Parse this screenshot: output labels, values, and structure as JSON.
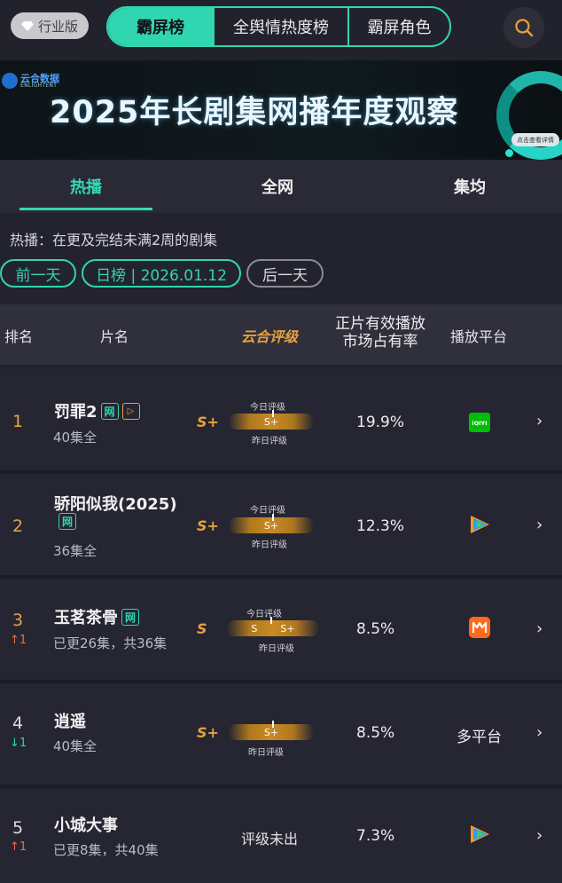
{
  "topbar": {
    "industry_label": "行业版",
    "tabs": [
      "霸屏榜",
      "全舆情热度榜",
      "霸屏角色"
    ],
    "active_tab": "霸屏榜"
  },
  "banner": {
    "brand_cn": "云合数据",
    "brand_en": "ENLIGHTENT",
    "title": "2025年长剧集网播年度观察",
    "detail_btn": "点击查看详情"
  },
  "subtabs": [
    "热播",
    "全网",
    "集均"
  ],
  "active_subtab": "热播",
  "info": {
    "description": "热播：在更及完结未满2周的剧集",
    "prev_day": "前一天",
    "date_label": "日榜 | 2026.01.12",
    "next_day": "后一天"
  },
  "table": {
    "headers": {
      "rank": "排名",
      "title": "片名",
      "grade": "云合评级",
      "share_line1": "正片有效播放",
      "share_line2": "市场占有率",
      "platform": "播放平台"
    },
    "grade_today_label": "今日评级",
    "grade_yesterday_label": "昨日评级",
    "rows": [
      {
        "rank": "1",
        "trend": "",
        "trend_dir": "",
        "title": "罚罪2",
        "net_badge": "网",
        "play_badge": "▷",
        "episodes": "40集全",
        "grade": "S+",
        "bar_left": "S+",
        "bar_right": "",
        "share": "19.9%",
        "platform": "iqiyi-icon",
        "platform_text": "iQIYI"
      },
      {
        "rank": "2",
        "trend": "",
        "trend_dir": "",
        "title": "骄阳似我(2025)",
        "net_badge": "网",
        "play_badge": "",
        "episodes": "36集全",
        "grade": "S+",
        "bar_left": "S+",
        "bar_right": "",
        "share": "12.3%",
        "platform": "tencent-video-icon",
        "platform_text": ""
      },
      {
        "rank": "3",
        "trend": "↑1",
        "trend_dir": "up",
        "title": "玉茗茶骨",
        "net_badge": "网",
        "play_badge": "",
        "episodes": "已更26集，共36集",
        "grade": "S",
        "bar_left": "S",
        "bar_right": "S+",
        "share": "8.5%",
        "platform": "mango-tv-icon",
        "platform_text": ""
      },
      {
        "rank": "4",
        "trend": "↓1",
        "trend_dir": "down",
        "title": "逍遥",
        "net_badge": "",
        "play_badge": "",
        "episodes": "40集全",
        "grade": "S+",
        "bar_left": "S+",
        "bar_right": "",
        "share": "8.5%",
        "platform": "",
        "platform_text": "多平台"
      },
      {
        "rank": "5",
        "trend": "↑1",
        "trend_dir": "up",
        "title": "小城大事",
        "net_badge": "",
        "play_badge": "",
        "episodes": "已更8集，共40集",
        "grade_none": "评级未出",
        "share": "7.3%",
        "platform": "tencent-video-icon",
        "platform_text": ""
      }
    ]
  },
  "colors": {
    "accent": "#2fd6b0",
    "gold": "#e5a23e",
    "up": "#ef6a4a",
    "background": "#23232f"
  }
}
